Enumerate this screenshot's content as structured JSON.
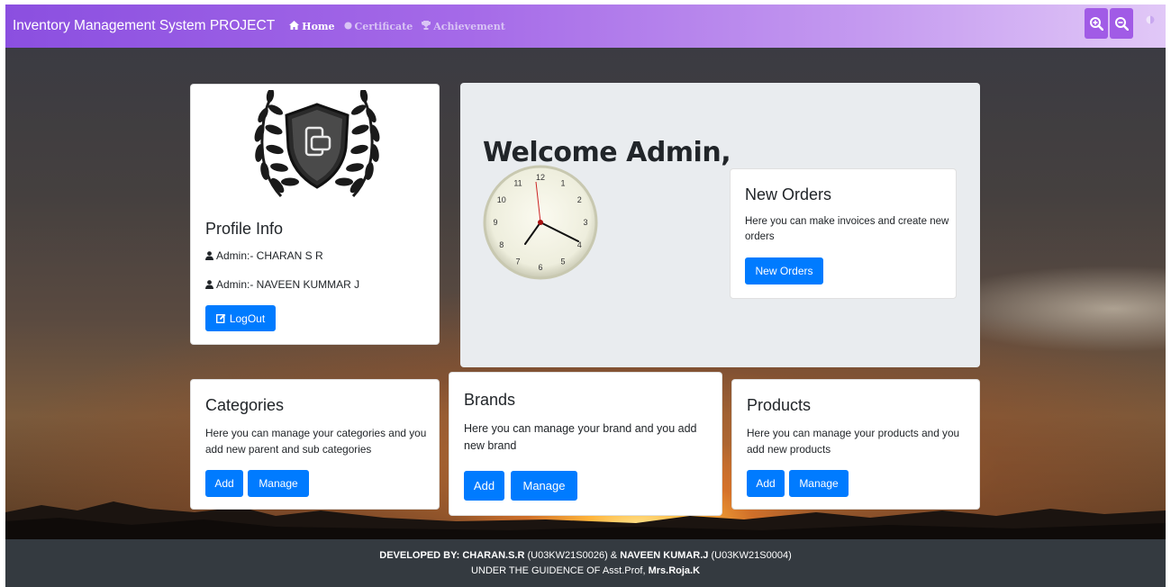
{
  "navbar": {
    "brand": "Inventory Management System PROJECT",
    "links": [
      {
        "label": "Home",
        "icon": "home-icon"
      },
      {
        "label": "Certificate",
        "icon": "circle-icon"
      },
      {
        "label": "Achievement",
        "icon": "trophy-icon"
      }
    ],
    "zoom_in_icon": "zoom-in-icon",
    "zoom_out_icon": "zoom-out-icon",
    "contrast_icon": "contrast-icon"
  },
  "profile": {
    "title": "Profile Info",
    "admins": [
      "Admin:- CHARAN S R",
      "Admin:- NAVEEN KUMMAR J"
    ],
    "logout_label": "LogOut"
  },
  "welcome": {
    "heading": "Welcome Admin,",
    "clock_numbers": [
      "12",
      "1",
      "2",
      "3",
      "4",
      "5",
      "6",
      "7",
      "8",
      "9",
      "10",
      "11"
    ]
  },
  "new_orders": {
    "title": "New Orders",
    "desc": "Here you can make invoices and create new orders",
    "button": "New Orders"
  },
  "categories": {
    "title": "Categories",
    "desc": "Here you can manage your categories and you add new parent and sub categories",
    "add": "Add",
    "manage": "Manage"
  },
  "brands": {
    "title": "Brands",
    "desc": "Here you can manage your brand and you add new brand",
    "add": "Add",
    "manage": "Manage"
  },
  "products": {
    "title": "Products",
    "desc": "Here you can manage your products and you add new products",
    "add": "Add",
    "manage": "Manage"
  },
  "footer": {
    "developed_by": "DEVELOPED BY:",
    "dev1_name": "CHARAN.S.R",
    "dev1_id": "(U03KW21S0026) &",
    "dev2_name": "NAVEEN KUMAR.J",
    "dev2_id": "(U03KW21S0004)",
    "guidance": "UNDER THE GUIDENCE OF Asst.Prof,",
    "guide_name": "Mrs.Roja.K"
  },
  "colors": {
    "primary": "#007bff",
    "navbar_start": "#8b4fe0",
    "footer": "#343a40"
  }
}
